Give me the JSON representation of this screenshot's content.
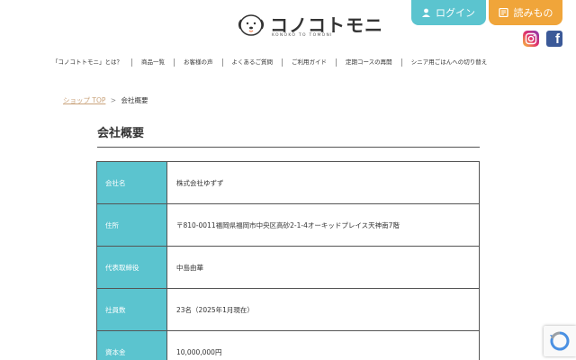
{
  "header": {
    "logo_text": "コノコトモニ",
    "logo_ruby": "KONOKO TO TOMONI",
    "logo_dot": "ト",
    "login_label": "ログイン",
    "read_label": "読みもの"
  },
  "nav": {
    "items": [
      "「コノコトトモニ」とは？",
      "商品一覧",
      "お客様の声",
      "よくあるご質問",
      "ご利用ガイド",
      "定期コースの再開",
      "シニア用ごはんへの切り替え"
    ]
  },
  "breadcrumb": {
    "link": "ショップ TOP",
    "separator": ">",
    "current": "会社概要"
  },
  "page": {
    "title": "会社概要"
  },
  "company_table": {
    "rows": [
      {
        "label": "会社名",
        "value": "株式会社ゆずず"
      },
      {
        "label": "住所",
        "value": "〒810-0011福岡県福岡市中央区高砂2-1-4オーキッドプレイス天神南7階"
      },
      {
        "label": "代表取締役",
        "value": "中島由華"
      },
      {
        "label": "社員数",
        "value": "23名（2025年1月現在）"
      },
      {
        "label": "資本金",
        "value": "10,000,000円"
      }
    ]
  },
  "colors": {
    "teal": "#5bc4cf",
    "orange": "#f0a53a",
    "link_brown": "#c9a27a"
  }
}
